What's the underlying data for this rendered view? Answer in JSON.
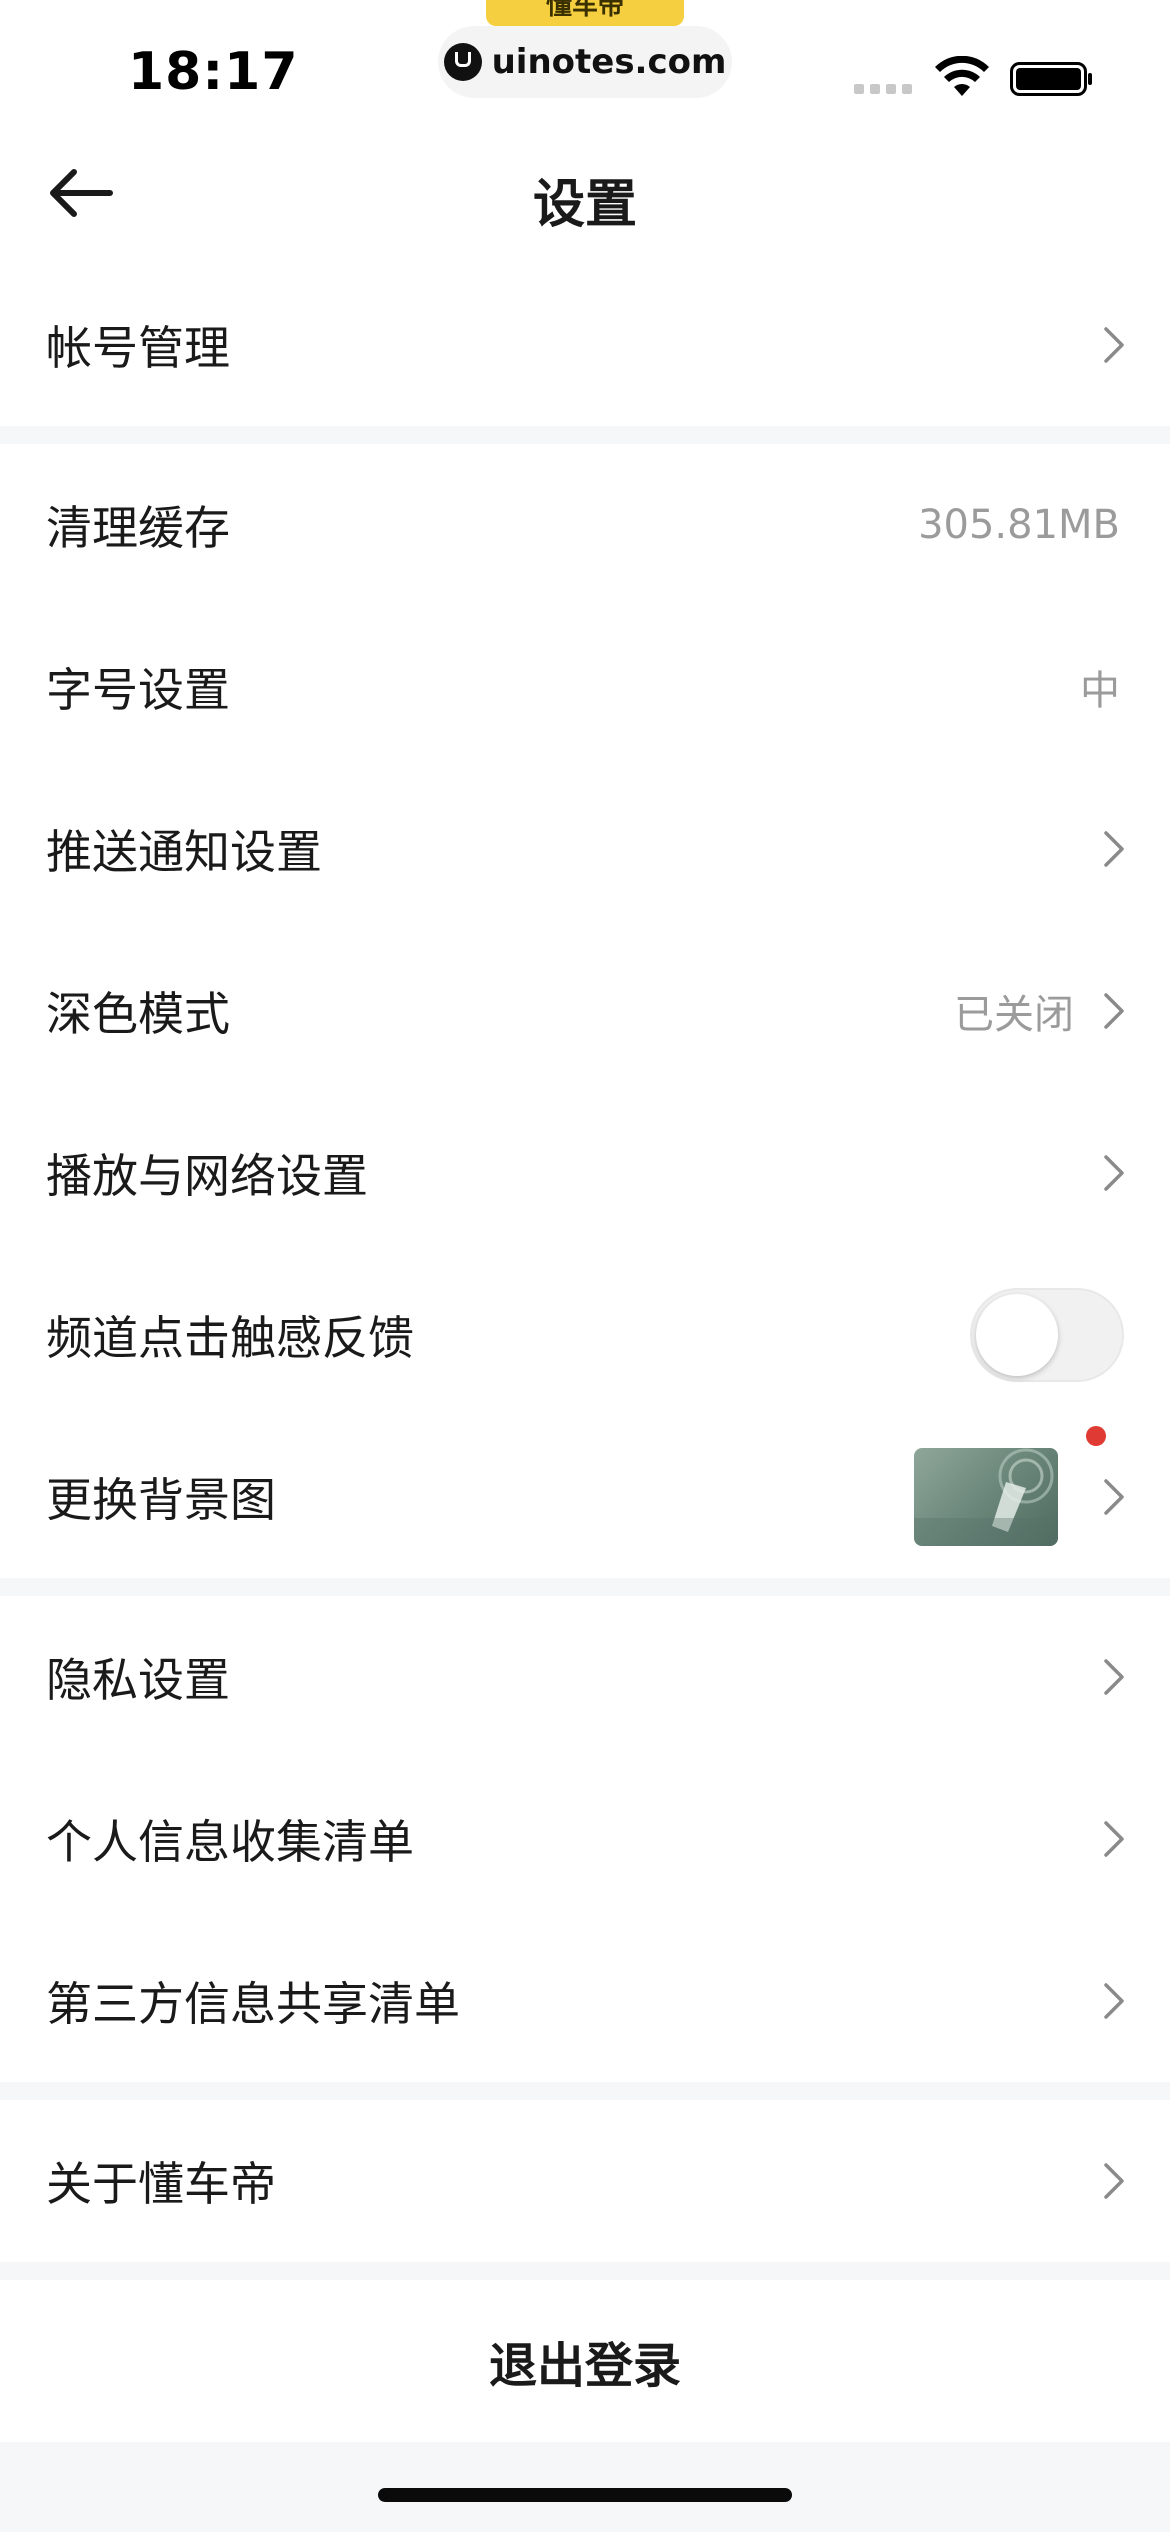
{
  "status_bar": {
    "time": "18:17",
    "app_tab": "懂车帝",
    "url": "uinotes.com"
  },
  "nav": {
    "title": "设置"
  },
  "settings": {
    "account": {
      "label": "帐号管理"
    },
    "cache": {
      "label": "清理缓存",
      "value": "305.81MB"
    },
    "font_size": {
      "label": "字号设置",
      "value": "中"
    },
    "push": {
      "label": "推送通知设置"
    },
    "dark_mode": {
      "label": "深色模式",
      "value": "已关闭"
    },
    "playback": {
      "label": "播放与网络设置"
    },
    "haptic": {
      "label": "频道点击触感反馈",
      "enabled": false
    },
    "background": {
      "label": "更换背景图",
      "has_badge": true
    },
    "privacy": {
      "label": "隐私设置"
    },
    "personal_info": {
      "label": "个人信息收集清单"
    },
    "third_party": {
      "label": "第三方信息共享清单"
    },
    "about": {
      "label": "关于懂车帝"
    }
  },
  "logout": {
    "label": "退出登录"
  },
  "colors": {
    "badge": "#e03a35",
    "secondary_text": "#9b9b9b",
    "divider": "#f6f7f8",
    "app_tab": "#f5cf3f"
  },
  "icons": [
    "back-arrow-icon",
    "chevron-right-icon",
    "wifi-icon",
    "battery-icon"
  ]
}
